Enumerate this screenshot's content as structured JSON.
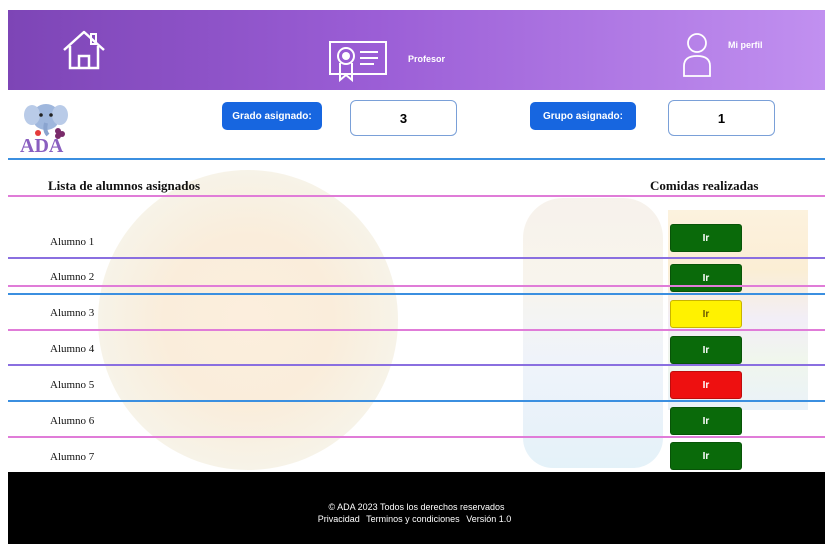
{
  "header": {
    "role_label": "Profesor",
    "profile_label": "Mi perfil"
  },
  "logo": {
    "text": "ADA"
  },
  "assignment": {
    "grade_label": "Grado asignado:",
    "grade_value": "3",
    "group_label": "Grupo asignado:",
    "group_value": "1"
  },
  "list": {
    "title": "Lista de alumnos asignados",
    "meals_title": "Comidas realizadas",
    "button_label": "Ir",
    "students": [
      {
        "name": "Alumno 1",
        "status_color": "#0a6a0a"
      },
      {
        "name": "Alumno 2",
        "status_color": "#0a6a0a"
      },
      {
        "name": "Alumno  3",
        "status_color": "#fff200"
      },
      {
        "name": "Alumno 4",
        "status_color": "#0a6a0a"
      },
      {
        "name": "Alumno 5",
        "status_color": "#ee1010"
      },
      {
        "name": "Alumno 6",
        "status_color": "#0a6a0a"
      },
      {
        "name": "Alumno 7",
        "status_color": "#0a6a0a"
      }
    ]
  },
  "footer": {
    "copyright": "© ADA 2023 Todos los derechos reservados",
    "privacy": "Privacidad",
    "terms": "Terminos y condiciones",
    "version": "Versión 1.0"
  }
}
